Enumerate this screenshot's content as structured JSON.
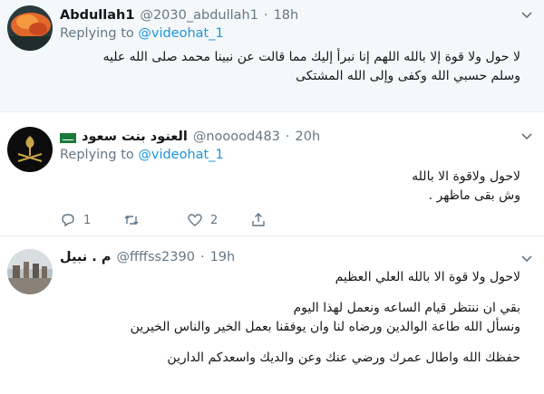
{
  "tweets": [
    {
      "name": "Abdullah1",
      "handle": "@2030_abdullah1",
      "time": "18h",
      "replying_prefix": "Replying to",
      "replying_to": "@videohat_1",
      "lines": [
        "لا حول ولا قوة إلا بالله اللهم إنا نبرأ إليك مما قالت عن نبينا محمد صلى الله عليه",
        "وسلم حسبي الله وكفى وإلى الله المشتكى"
      ]
    },
    {
      "name": "العنود بنت سعود",
      "handle": "@nooood483",
      "time": "20h",
      "replying_prefix": "Replying to",
      "replying_to": "@videohat_1",
      "lines": [
        "لاحول ولاقوة الا بالله",
        "وش بقى ماظهر ."
      ],
      "actions": {
        "reply": "1",
        "retweet": "",
        "like": "2",
        "share": ""
      }
    },
    {
      "name": "م . نبيل",
      "handle": "@ffffss2390",
      "time": "19h",
      "lines": [
        "لاحول ولا قوة الا بالله العلي العظيم",
        "بقي ان ننتظر قيام الساعه    ونعمل لهذا اليوم",
        "ونسأل الله طاعة  الوالدين ورضاه لنا    وان يوفقنا بعمل الخير والناس الخيرين",
        "حفظك الله واطال عمرك ورضي عنك وعن والديك واسعدكم الدارين"
      ]
    }
  ],
  "separator": "·",
  "icons": {
    "caret": "chevron-down-icon",
    "reply": "reply-icon",
    "retweet": "retweet-icon",
    "like": "heart-icon",
    "share": "share-icon"
  },
  "colors": {
    "link": "#1b95e0",
    "meta": "#657786",
    "highlight_bg": "#f5f8fa"
  }
}
